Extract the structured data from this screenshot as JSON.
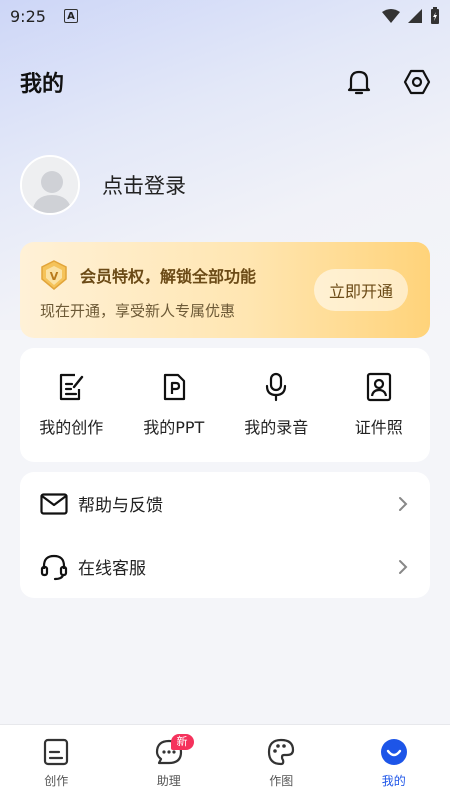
{
  "status_bar": {
    "time": "9:25",
    "notification_letter": "A"
  },
  "header": {
    "title": "我的"
  },
  "profile": {
    "login_text": "点击登录"
  },
  "vip": {
    "title": "会员特权，解锁全部功能",
    "subtitle": "现在开通，享受新人专属优惠",
    "button": "立即开通",
    "badge_letter": "V"
  },
  "shortcuts": [
    {
      "label": "我的创作",
      "icon": "edit-note-icon"
    },
    {
      "label": "我的PPT",
      "icon": "ppt-file-icon"
    },
    {
      "label": "我的录音",
      "icon": "microphone-icon"
    },
    {
      "label": "证件照",
      "icon": "id-photo-icon"
    }
  ],
  "menu": [
    {
      "label": "帮助与反馈",
      "icon": "mail-icon"
    },
    {
      "label": "在线客服",
      "icon": "headset-icon"
    }
  ],
  "tabbar": {
    "tabs": [
      {
        "label": "创作",
        "icon": "document-icon"
      },
      {
        "label": "助理",
        "icon": "chat-bubble-icon",
        "badge": "新"
      },
      {
        "label": "作图",
        "icon": "palette-icon"
      },
      {
        "label": "我的",
        "icon": "smile-profile-icon",
        "active": true
      }
    ]
  },
  "colors": {
    "accent": "#1d55e8",
    "badge": "#f5325c",
    "vip_text": "#6b4a16"
  }
}
